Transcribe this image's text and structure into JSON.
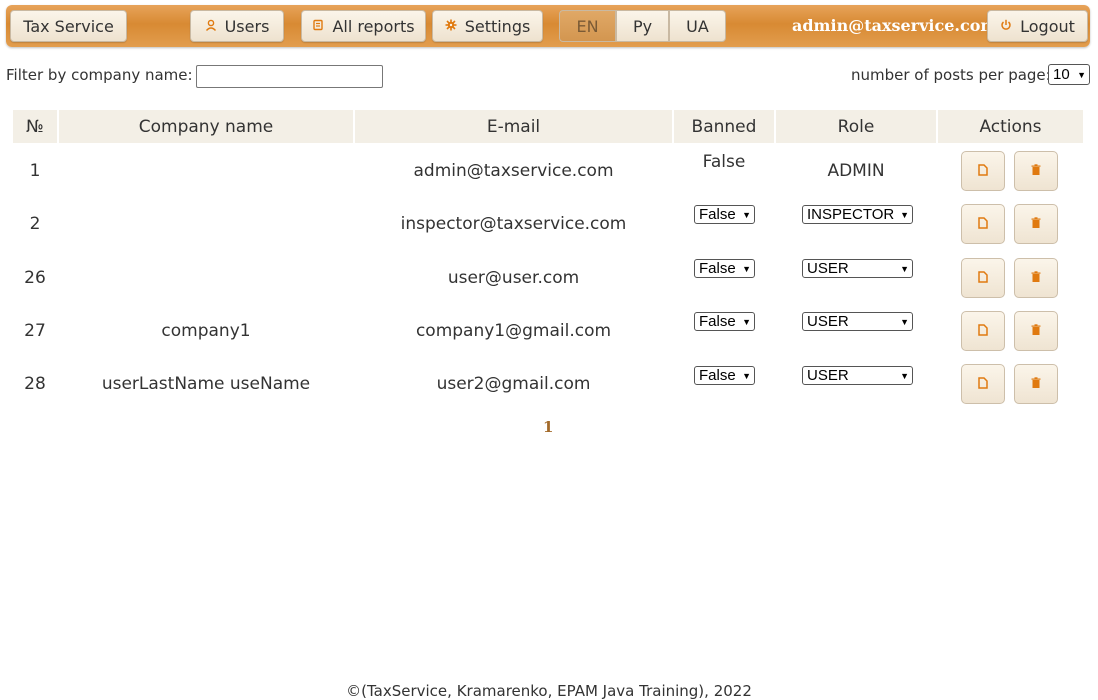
{
  "nav": {
    "brand": "Tax Service",
    "users": "Users",
    "all_reports": "All reports",
    "settings": "Settings",
    "languages": [
      "EN",
      "Py",
      "UA"
    ],
    "active_language": "EN",
    "user_email": "admin@taxservice.com",
    "logout": "Logout",
    "icons": {
      "users": "user-icon",
      "all_reports": "reports-icon",
      "settings": "gear-icon",
      "logout": "power-icon"
    }
  },
  "filter": {
    "label": "Filter by company name:",
    "value": "",
    "posts_label": "number of posts per page:",
    "posts_value": "10"
  },
  "table": {
    "headers": [
      "№",
      "Company name",
      "E-mail",
      "Banned",
      "Role",
      "Actions"
    ],
    "rows": [
      {
        "id": "1",
        "company": "",
        "email": "admin@taxservice.com",
        "banned": "False",
        "role": "ADMIN"
      },
      {
        "id": "2",
        "company": "",
        "email": "inspector@taxservice.com",
        "banned": "False",
        "role": "INSPECTOR"
      },
      {
        "id": "26",
        "company": "",
        "email": "user@user.com",
        "banned": "False",
        "role": "USER"
      },
      {
        "id": "27",
        "company": "company1",
        "email": "company1@gmail.com",
        "banned": "False",
        "role": "USER"
      },
      {
        "id": "28",
        "company": "userLastName useName",
        "email": "user2@gmail.com",
        "banned": "False",
        "role": "USER"
      }
    ]
  },
  "pagination": {
    "current": "1"
  },
  "footer": "©(TaxService, Kramarenko, EPAM Java Training), 2022",
  "colors": {
    "navbar": "#d88a33",
    "header_bg": "#f3efe6",
    "accent_icon": "#e07a10",
    "page_link": "#a36a2a"
  }
}
